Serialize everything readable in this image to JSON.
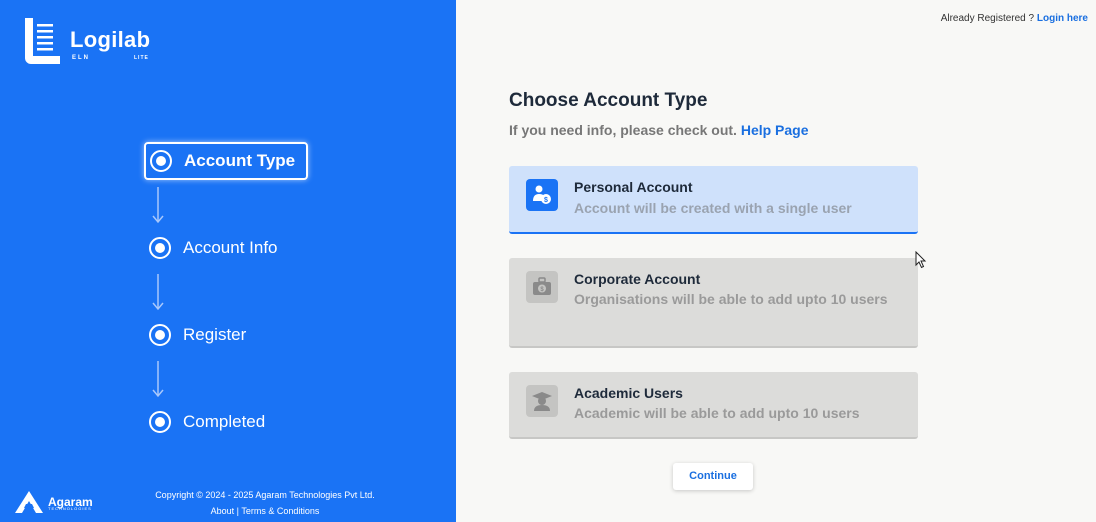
{
  "brand": {
    "name": "Logilab",
    "eln": "ELN",
    "lite": "LITE",
    "company": "Agaram",
    "company_sub": "TECHNOLOGIES"
  },
  "steps": [
    {
      "label": "Account Type",
      "active": true
    },
    {
      "label": "Account Info",
      "active": false
    },
    {
      "label": "Register",
      "active": false
    },
    {
      "label": "Completed",
      "active": false
    }
  ],
  "footer": {
    "copyright": "Copyright © 2024 - 2025 Agaram Technologies Pvt Ltd.",
    "about": "About",
    "separator": "|",
    "terms": "Terms & Conditions"
  },
  "header": {
    "already_registered": "Already Registered ?",
    "login": "Login here"
  },
  "main": {
    "title": "Choose Account Type",
    "subtitle": "If you need info, please check out.",
    "help_link": "Help Page",
    "cards": [
      {
        "title": "Personal Account",
        "desc": "Account will be created with a single user",
        "state": "selected"
      },
      {
        "title": "Corporate Account",
        "desc": "Organisations will be able to add upto 10 users",
        "state": "disabled"
      },
      {
        "title": "Academic Users",
        "desc": "Academic will be able to add upto 10 users",
        "state": "disabled"
      }
    ],
    "continue": "Continue"
  },
  "colors": {
    "primary": "#1a73f5",
    "selected_card": "#cfe1fb",
    "disabled_card": "#dcdcda",
    "link": "#1a6fe0"
  }
}
